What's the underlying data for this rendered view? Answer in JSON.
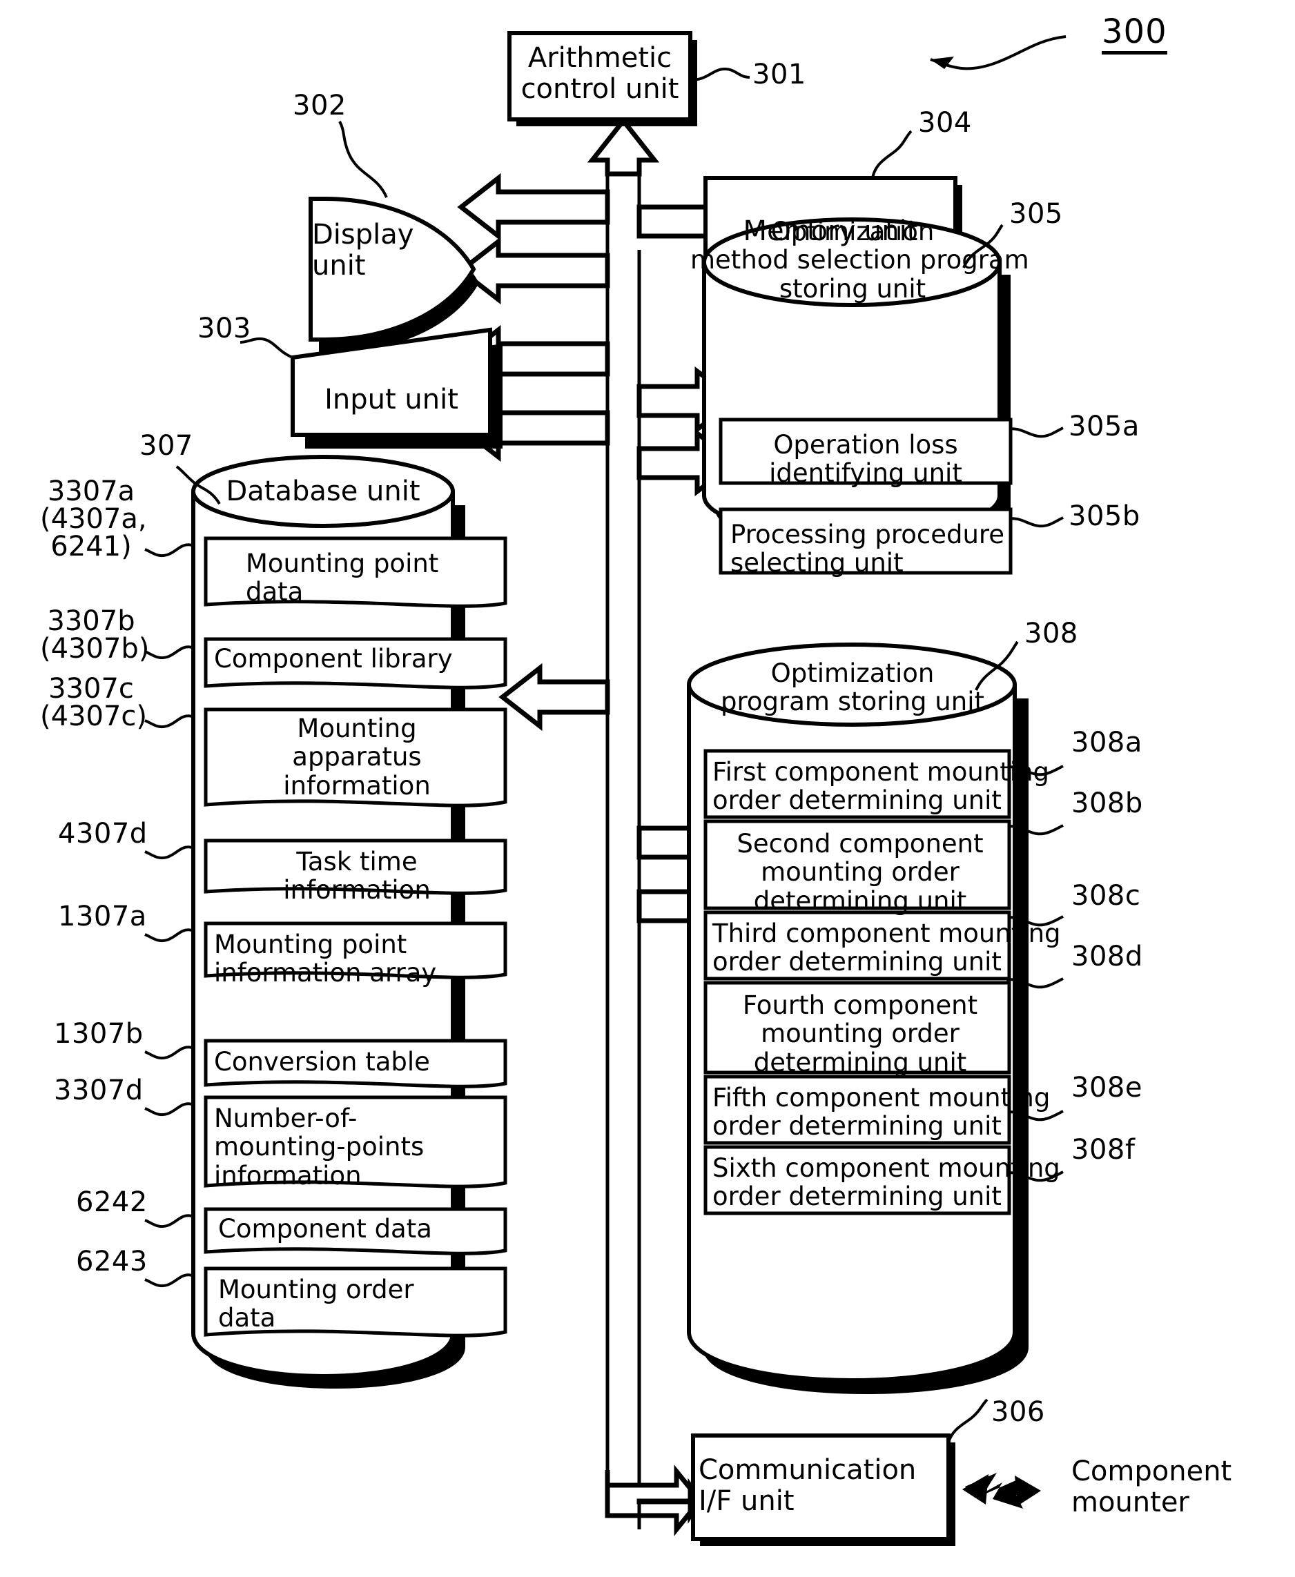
{
  "figure": {
    "number": "300",
    "external_device": "Component\nmounter"
  },
  "nodes": {
    "arithmetic_control_unit": {
      "label": "Arithmetic\ncontrol unit",
      "ref": "301"
    },
    "display_unit": {
      "label": "Display\nunit",
      "ref": "302"
    },
    "input_unit": {
      "label": "Input unit",
      "ref": "303"
    },
    "memory_unit": {
      "label": "Memory unit",
      "ref": "304"
    },
    "communication_if_unit": {
      "label": "Communication\nI/F unit",
      "ref": "306"
    }
  },
  "method_selection_unit": {
    "ref": "305",
    "title": "Optimization\nmethod selection program\nstoring unit",
    "items": [
      {
        "label": "Operation loss\nidentifying unit",
        "ref": "305a",
        "align": "center"
      },
      {
        "label": "Processing procedure\nselecting unit",
        "ref": "305b",
        "align": "left"
      }
    ]
  },
  "database_unit": {
    "ref": "307",
    "title": "Database unit",
    "items": [
      {
        "label": "Mounting point\ndata",
        "ref": "3307a\n(4307a,\n6241)",
        "align": "left"
      },
      {
        "label": "Component library",
        "ref": "3307b\n(4307b)",
        "align": "left"
      },
      {
        "label": "Mounting\napparatus\ninformation",
        "ref": "3307c\n(4307c)",
        "align": "center"
      },
      {
        "label": "Task time\ninformation",
        "ref": "4307d",
        "align": "center"
      },
      {
        "label": "Mounting point\ninformation array",
        "ref": "1307a",
        "align": "left"
      },
      {
        "label": "Conversion table",
        "ref": "1307b",
        "align": "left"
      },
      {
        "label": "Number-of-\nmounting-points\ninformation",
        "ref": "3307d",
        "align": "left"
      },
      {
        "label": "Component data",
        "ref": "6242",
        "align": "left"
      },
      {
        "label": "Mounting order\ndata",
        "ref": "6243",
        "align": "left"
      }
    ]
  },
  "optimization_program_unit": {
    "ref": "308",
    "title": "Optimization\nprogram storing unit",
    "items": [
      {
        "label": "First component mounting\norder determining unit",
        "ref": "308a",
        "align": "left"
      },
      {
        "label": "Second component\nmounting order\ndetermining unit",
        "ref": "308b",
        "align": "center"
      },
      {
        "label": "Third component mounting\norder determining unit",
        "ref": "308c",
        "align": "left"
      },
      {
        "label": "Fourth component\nmounting order\ndetermining unit",
        "ref": "308d",
        "align": "center"
      },
      {
        "label": "Fifth component mounting\norder determining unit",
        "ref": "308e",
        "align": "left"
      },
      {
        "label": "Sixth component mounting\norder determining unit",
        "ref": "308f",
        "align": "left"
      }
    ]
  },
  "colors": {
    "ink": "#000000",
    "paper": "#ffffff"
  }
}
